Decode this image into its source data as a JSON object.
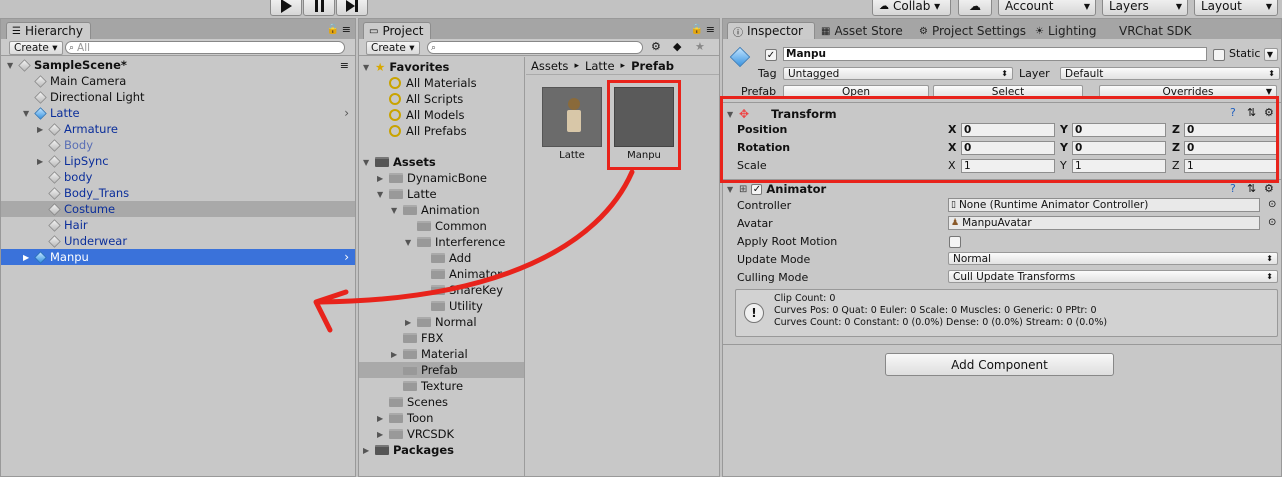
{
  "toolbar": {
    "play_icon": "play-icon",
    "pause_icon": "pause-icon",
    "step_icon": "step-icon",
    "collab": "Collab ▾",
    "account": "Account",
    "layers": "Layers",
    "layout": "Layout"
  },
  "hierarchy": {
    "tab": "Hierarchy",
    "create": "Create ▾",
    "search_placeholder": "All",
    "scene": "SampleScene*",
    "items": [
      {
        "label": "Main Camera"
      },
      {
        "label": "Directional Light"
      },
      {
        "label": "Latte"
      },
      {
        "label": "Armature"
      },
      {
        "label": "Body"
      },
      {
        "label": "LipSync"
      },
      {
        "label": "body"
      },
      {
        "label": "Body_Trans"
      },
      {
        "label": "Costume"
      },
      {
        "label": "Hair"
      },
      {
        "label": "Underwear"
      },
      {
        "label": "Manpu"
      }
    ]
  },
  "project": {
    "tab": "Project",
    "create": "Create ▾",
    "favorites_title": "Favorites",
    "favorites": [
      "All Materials",
      "All Scripts",
      "All Models",
      "All Prefabs"
    ],
    "assets_title": "Assets",
    "tree": [
      "DynamicBone",
      "Latte",
      "Animation",
      "Common",
      "Interference",
      "Add",
      "Animator",
      "ShareKey",
      "Utility",
      "Normal",
      "FBX",
      "Material",
      "Prefab",
      "Texture",
      "Scenes",
      "Toon",
      "VRCSDK"
    ],
    "packages_title": "Packages",
    "breadcrumb": [
      "Assets",
      "Latte",
      "Prefab"
    ],
    "files": [
      "Latte",
      "Manpu"
    ]
  },
  "inspector": {
    "tabs": [
      "Inspector",
      "Asset Store",
      "Project Settings",
      "Lighting",
      "VRChat SDK"
    ],
    "object_name": "Manpu",
    "static_label": "Static",
    "tag_label": "Tag",
    "tag_value": "Untagged",
    "layer_label": "Layer",
    "layer_value": "Default",
    "prefab_label": "Prefab",
    "prefab_open": "Open",
    "prefab_select": "Select",
    "prefab_overrides": "Overrides",
    "transform": {
      "title": "Transform",
      "rows": [
        {
          "label": "Position",
          "x": "0",
          "y": "0",
          "z": "0"
        },
        {
          "label": "Rotation",
          "x": "0",
          "y": "0",
          "z": "0"
        },
        {
          "label": "Scale",
          "x": "1",
          "y": "1",
          "z": "1"
        }
      ],
      "axis": [
        "X",
        "Y",
        "Z"
      ]
    },
    "animator": {
      "title": "Animator",
      "controller_label": "Controller",
      "controller_value": "None (Runtime Animator Controller)",
      "avatar_label": "Avatar",
      "avatar_value": "ManpuAvatar",
      "root_motion_label": "Apply Root Motion",
      "update_mode_label": "Update Mode",
      "update_mode_value": "Normal",
      "culling_mode_label": "Culling Mode",
      "culling_mode_value": "Cull Update Transforms",
      "info": [
        "Clip Count: 0",
        "Curves Pos: 0 Quat: 0 Euler: 0 Scale: 0 Muscles: 0 Generic: 0 PPtr: 0",
        "Curves Count: 0 Constant: 0 (0.0%) Dense: 0 (0.0%) Stream: 0 (0.0%)"
      ]
    },
    "add_component": "Add Component"
  },
  "colors": {
    "selection_blue": "#3a72da",
    "annotation_red": "#e8231b"
  }
}
